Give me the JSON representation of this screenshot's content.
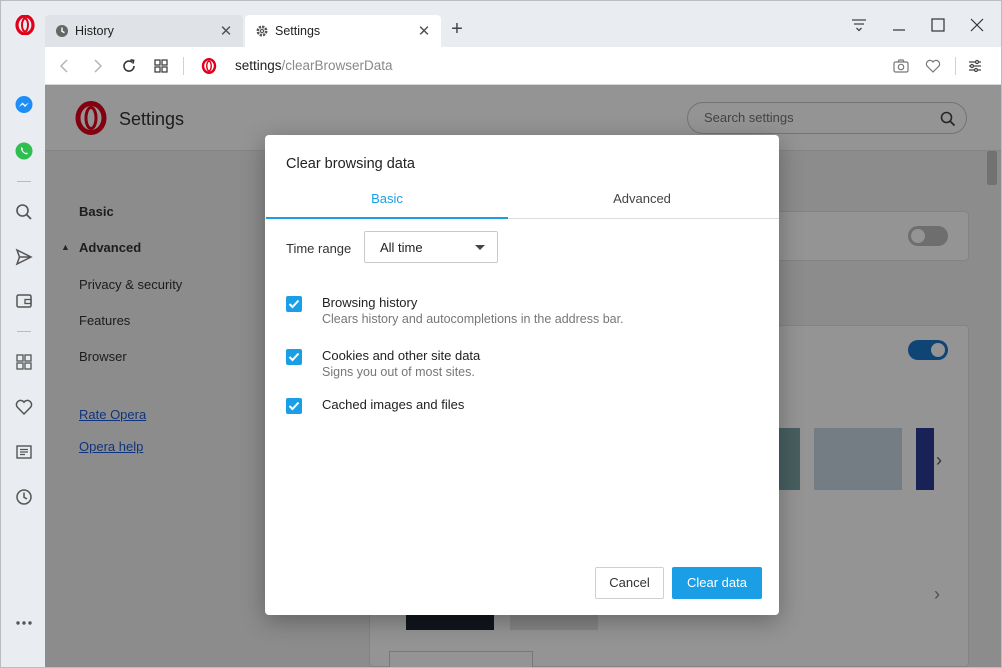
{
  "tabs": [
    {
      "label": "History",
      "icon": "clock-icon"
    },
    {
      "label": "Settings",
      "icon": "gear-icon"
    }
  ],
  "address": {
    "host": "settings",
    "path": "/clearBrowserData"
  },
  "settings": {
    "title": "Settings",
    "search_placeholder": "Search settings",
    "nav": {
      "basic": "Basic",
      "advanced": "Advanced",
      "privacy": "Privacy & security",
      "features": "Features",
      "browser": "Browser",
      "rate": "Rate Opera",
      "help": "Opera help"
    }
  },
  "dialog": {
    "title": "Clear browsing data",
    "tabs": {
      "basic": "Basic",
      "advanced": "Advanced"
    },
    "active_tab": "Basic",
    "time_range_label": "Time range",
    "time_range_value": "All time",
    "options": [
      {
        "title": "Browsing history",
        "desc": "Clears history and autocompletions in the address bar.",
        "checked": true
      },
      {
        "title": "Cookies and other site data",
        "desc": "Signs you out of most sites.",
        "checked": true
      },
      {
        "title": "Cached images and files",
        "desc": "",
        "checked": true
      }
    ],
    "cancel_label": "Cancel",
    "confirm_label": "Clear data"
  },
  "colors": {
    "accent": "#1a9ee5",
    "opera_red": "#e0001a",
    "link": "#1a5ad7"
  }
}
